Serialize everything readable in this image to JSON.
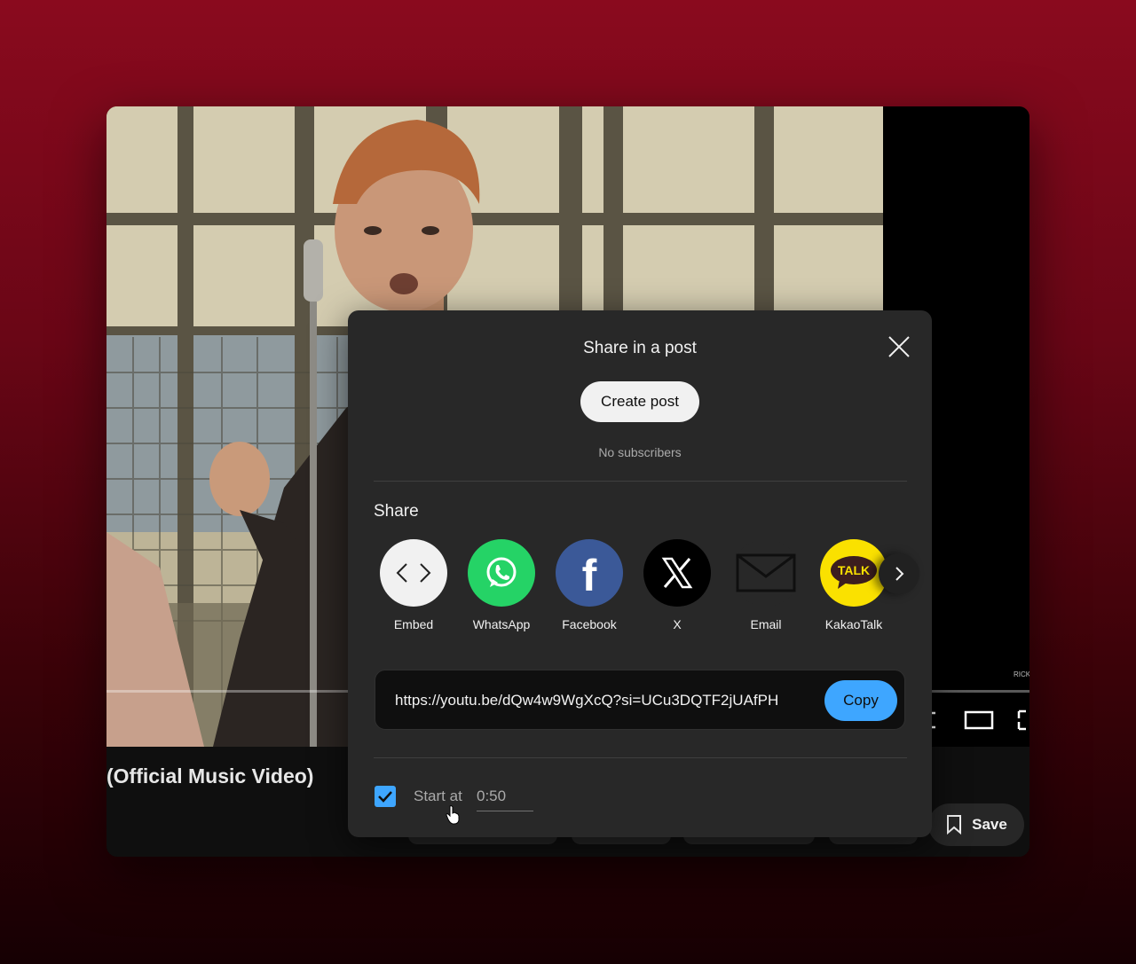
{
  "video": {
    "title_fragment": "(Official Music Video)",
    "overlay_text": "RICK"
  },
  "actions": {
    "save_label": "Save"
  },
  "dialog": {
    "title": "Share in a post",
    "create_post_label": "Create post",
    "subscribers_text": "No subscribers",
    "share_heading": "Share",
    "share_targets": [
      {
        "label": "Embed",
        "icon": "embed-icon",
        "color": "#f1f1f1"
      },
      {
        "label": "WhatsApp",
        "icon": "whatsapp-icon",
        "color": "#25d366"
      },
      {
        "label": "Facebook",
        "icon": "facebook-icon",
        "color": "#3b5998"
      },
      {
        "label": "X",
        "icon": "x-logo-icon",
        "color": "#000000"
      },
      {
        "label": "Email",
        "icon": "email-icon",
        "color": "#282828"
      },
      {
        "label": "KakaoTalk",
        "icon": "kakaotalk-icon",
        "color": "#fae100"
      }
    ],
    "url": "https://youtu.be/dQw4w9WgXcQ?si=UCu3DQTF2jUAfPH",
    "copy_label": "Copy",
    "start_at_label": "Start at",
    "start_at_value": "0:50",
    "start_at_checked": true,
    "accent_color": "#3ea6ff"
  }
}
